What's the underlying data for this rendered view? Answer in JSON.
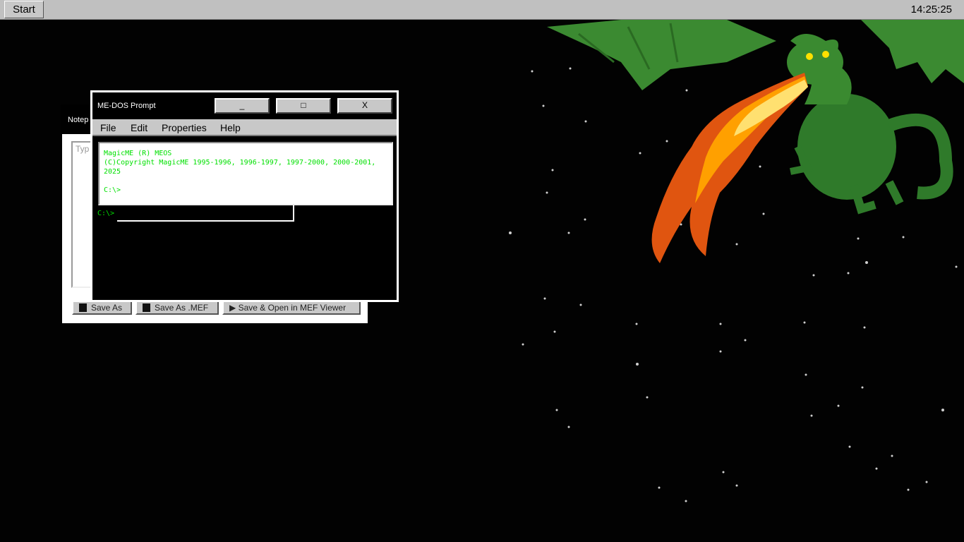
{
  "taskbar": {
    "start_label": "Start",
    "clock": "14:25:25"
  },
  "notepad": {
    "title": "Notep",
    "placeholder": "Typ",
    "buttons": {
      "save_as": "Save As",
      "save_as_mef": "Save As .MEF",
      "save_open_mef": "Save & Open in MEF Viewer"
    }
  },
  "dos": {
    "title": "ME-DOS Prompt",
    "buttons": {
      "minimize": "_",
      "maximize": "□",
      "close": "X"
    },
    "menu": {
      "file": "File",
      "edit": "Edit",
      "properties": "Properties",
      "help": "Help"
    },
    "output": {
      "line1": "MagicME (R) MEOS",
      "line2": "(C)Copyright MagicME 1995-1996, 1996-1997, 1997-2000, 2000-2001, 2025",
      "line3": "C:\\>"
    },
    "prompt_label": "C:\\>",
    "input_value": ""
  },
  "wallpaper": {
    "subject": "green dragon breathing fire",
    "colors": {
      "background": "#020202",
      "dragon": "#2f7a2a",
      "fire": "#ffb300"
    }
  }
}
